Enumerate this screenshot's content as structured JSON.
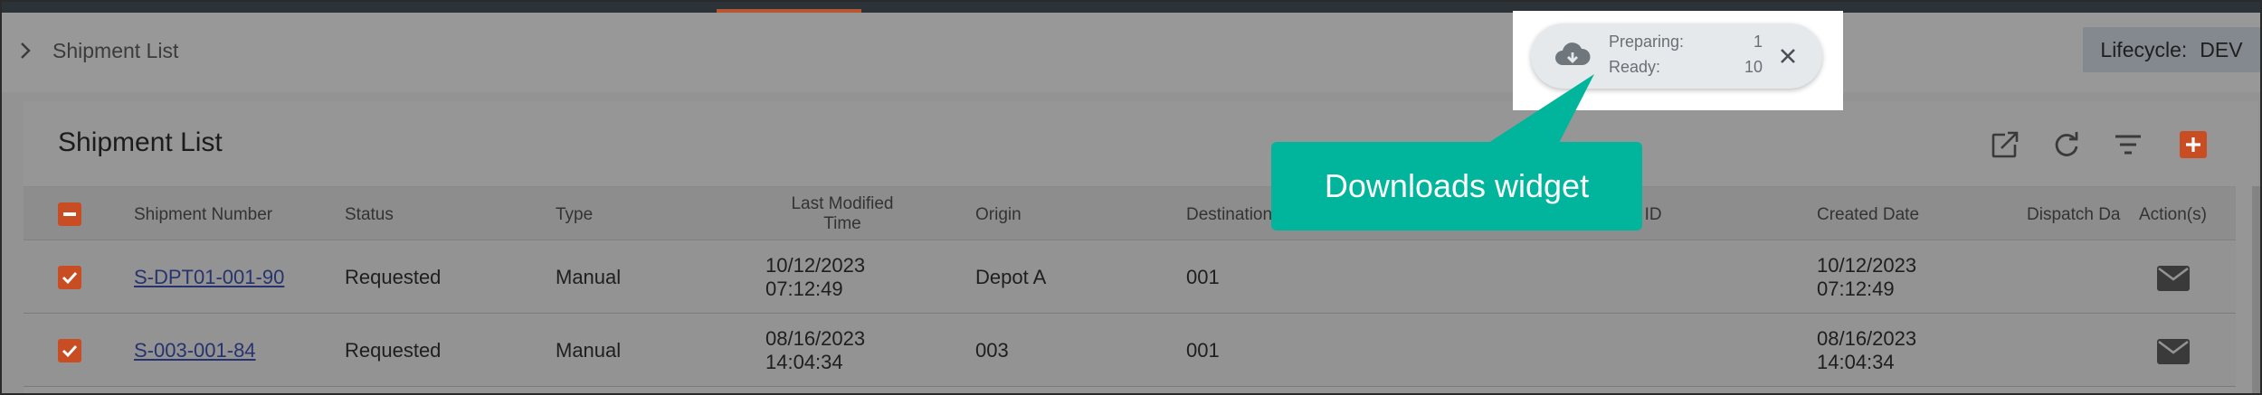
{
  "nav": {
    "breadcrumb_title": "Shipment List",
    "lifecycle_label": "Lifecycle:",
    "lifecycle_value": "DEV"
  },
  "downloads": {
    "preparing_label": "Preparing:",
    "preparing_count": "1",
    "ready_label": "Ready:",
    "ready_count": "10",
    "icon": "cloud-download-icon"
  },
  "panel": {
    "title": "Shipment List",
    "toolbar_icons": [
      "open-external-icon",
      "refresh-icon",
      "filter-icon",
      "add-icon"
    ]
  },
  "table": {
    "headers": {
      "shipment_number": "Shipment Number",
      "status": "Status",
      "type": "Type",
      "last_modified_1": "Last Modified",
      "last_modified_2": "Time",
      "origin": "Origin",
      "destination": "Destination",
      "tracking_id": "cking ID",
      "created_date": "Created Date",
      "dispatch_date": "Dispatch Da",
      "actions": "Action(s)"
    },
    "rows": [
      {
        "shipment_number": "S-DPT01-001-90",
        "status": "Requested",
        "type": "Manual",
        "modified_date": "10/12/2023",
        "modified_time": "07:12:49",
        "origin": "Depot A",
        "destination": "001",
        "created_date": "10/12/2023",
        "created_time": "07:12:49"
      },
      {
        "shipment_number": "S-003-001-84",
        "status": "Requested",
        "type": "Manual",
        "modified_date": "08/16/2023",
        "modified_time": "14:04:34",
        "origin": "003",
        "destination": "001",
        "created_date": "08/16/2023",
        "created_time": "14:04:34"
      }
    ]
  },
  "callout": {
    "text": "Downloads widget"
  },
  "colors": {
    "accent": "#c84d22",
    "callout": "#00b59b",
    "link": "#27336e"
  }
}
